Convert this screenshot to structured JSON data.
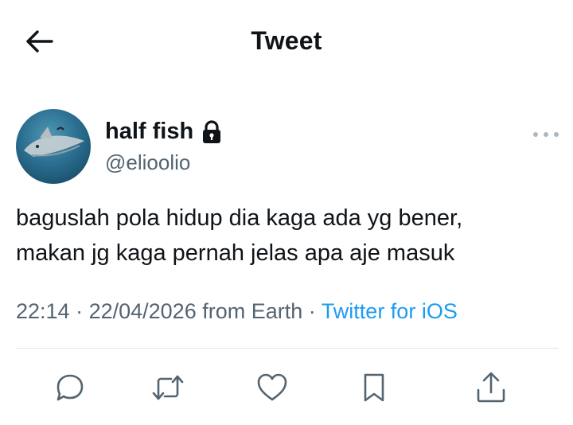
{
  "header": {
    "title": "Tweet"
  },
  "author": {
    "name": "half fish",
    "handle": "@elioolio",
    "protected": true
  },
  "tweet": {
    "lines": [
      "baguslah pola hidup dia kaga ada yg bener,",
      "makan jg kaga pernah jelas apa aje masuk"
    ],
    "time": "22:14",
    "date": "22/04/2026",
    "location": "from Earth",
    "source": "Twitter for iOS"
  },
  "colors": {
    "accent": "#1d9bf0",
    "secondary_text": "#536471",
    "text": "#0f1419"
  },
  "icons": [
    "back-arrow-icon",
    "lock-icon",
    "more-icon",
    "reply-icon",
    "retweet-icon",
    "like-icon",
    "bookmark-icon",
    "share-icon"
  ]
}
